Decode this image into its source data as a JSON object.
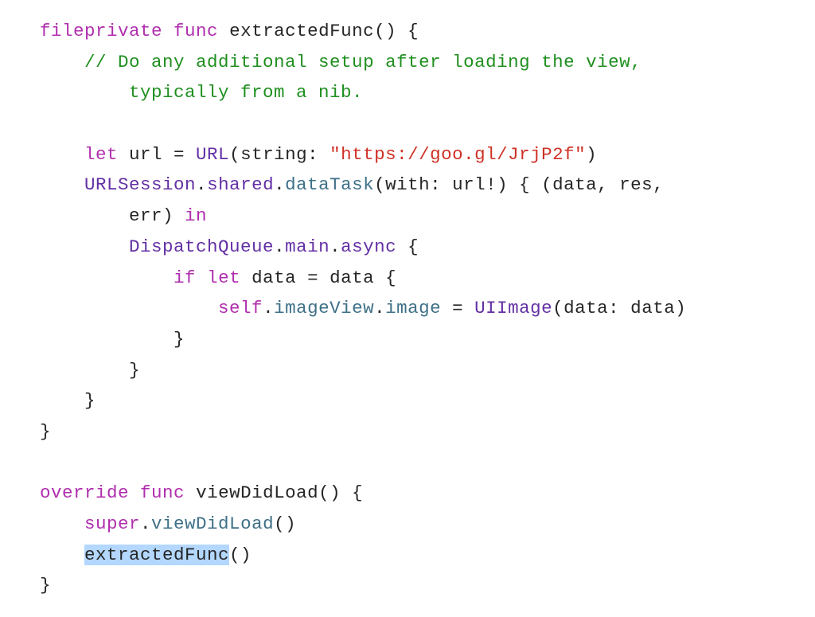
{
  "code": {
    "l1a": "fileprivate",
    "l1b": "func",
    "l1c": " extractedFunc() {",
    "l2": "    // Do any additional setup after loading the view,",
    "l3": "        typically from a nib.",
    "l4": "",
    "l5a": "    ",
    "l5b": "let",
    "l5c": " url = ",
    "l5d": "URL",
    "l5e": "(string: ",
    "l5f": "\"https://goo.gl/JrjP2f\"",
    "l5g": ")",
    "l6a": "    ",
    "l6b": "URLSession",
    "l6c": ".",
    "l6d": "shared",
    "l6e": ".",
    "l6f": "dataTask",
    "l6g": "(with: url!) { (data, res,",
    "l7a": "        err) ",
    "l7b": "in",
    "l8a": "        ",
    "l8b": "DispatchQueue",
    "l8c": ".",
    "l8d": "main",
    "l8e": ".",
    "l8f": "async",
    "l8g": " {",
    "l9a": "            ",
    "l9b": "if",
    "l9c": " ",
    "l9d": "let",
    "l9e": " data = data {",
    "l10a": "                ",
    "l10b": "self",
    "l10c": ".",
    "l10d": "imageView",
    "l10e": ".",
    "l10f": "image",
    "l10g": " = ",
    "l10h": "UIImage",
    "l10i": "(data: data)",
    "l11": "            }",
    "l12": "        }",
    "l13": "    }",
    "l14": "}",
    "l15": "",
    "l16a": "override",
    "l16b": " ",
    "l16c": "func",
    "l16d": " viewDidLoad() {",
    "l17a": "    ",
    "l17b": "super",
    "l17c": ".",
    "l17d": "viewDidLoad",
    "l17e": "()",
    "l18a": "    ",
    "l18b": "extractedFunc",
    "l18c": "()",
    "l19": "}"
  }
}
